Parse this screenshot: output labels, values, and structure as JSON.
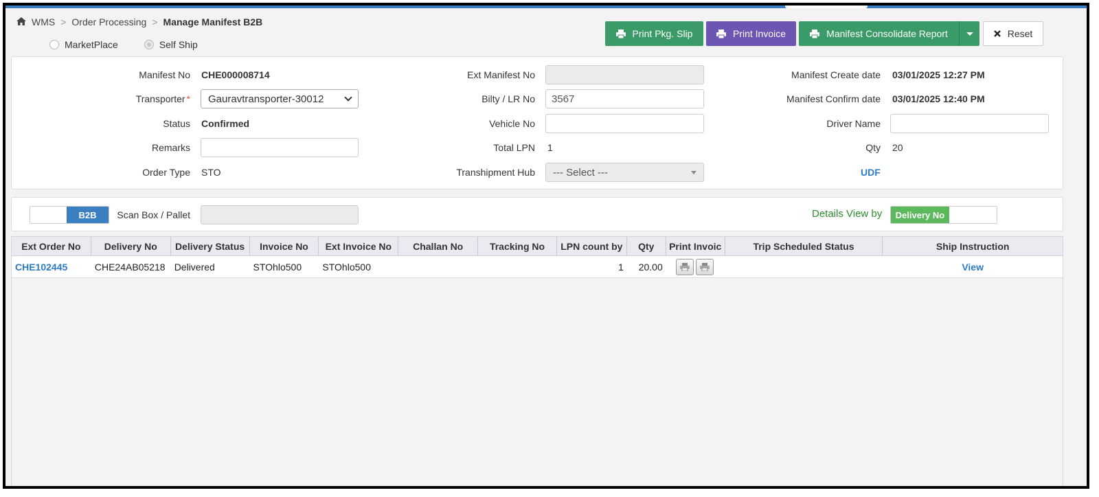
{
  "breadcrumb": {
    "root": "WMS",
    "sep": ">",
    "parent": "Order Processing",
    "current": "Manage Manifest B2B"
  },
  "ship_mode": {
    "options": [
      "MarketPlace",
      "Self Ship"
    ],
    "selected": "Self Ship"
  },
  "toolbar": {
    "print_pkg_slip": "Print Pkg. Slip",
    "print_invoice": "Print Invoice",
    "manifest_report": "Manifest Consolidate Report",
    "reset": "Reset"
  },
  "icons": {
    "home": "home-icon",
    "printer": "printer-icon",
    "close": "close-icon",
    "caret": "caret-down-icon"
  },
  "colors": {
    "green": "#3a9a68",
    "purple": "#6d55b3",
    "blue": "#3a7fc2",
    "link": "#2b7bc4",
    "toggle_green": "#5cb85c"
  },
  "form": {
    "manifest_no_label": "Manifest No",
    "manifest_no": "CHE000008714",
    "transporter_label": "Transporter",
    "required_mark": "*",
    "transporter": "Gauravtransporter-30012",
    "status_label": "Status",
    "status": "Confirmed",
    "remarks_label": "Remarks",
    "remarks": "",
    "order_type_label": "Order Type",
    "order_type": "STO",
    "ext_manifest_label": "Ext Manifest No",
    "ext_manifest": "",
    "bilty_label": "Bilty / LR No",
    "bilty": "3567",
    "vehicle_label": "Vehicle No",
    "vehicle": "",
    "total_lpn_label": "Total LPN",
    "total_lpn": "1",
    "hub_label": "Transhipment Hub",
    "hub": "--- Select ---",
    "create_date_label": "Manifest Create date",
    "create_date": "03/01/2025 12:27 PM",
    "confirm_date_label": "Manifest Confirm date",
    "confirm_date": "03/01/2025 12:40 PM",
    "driver_label": "Driver Name",
    "driver": "",
    "qty_label": "Qty",
    "qty": "20",
    "udf": "UDF"
  },
  "scan": {
    "toggle_label": "B2B",
    "scan_label": "Scan Box / Pallet",
    "scan_value": "",
    "details_label": "Details View by",
    "details_toggle": "Delivery No"
  },
  "table": {
    "headers": [
      "Ext Order No",
      "Delivery No",
      "Delivery Status",
      "Invoice No",
      "Ext Invoice No",
      "Challan No",
      "Tracking No",
      "LPN count by",
      "Qty",
      "Print Invoic",
      "Trip Scheduled Status",
      "Ship Instruction"
    ],
    "rows": [
      {
        "ext_order_no": "CHE102445",
        "delivery_no": "CHE24AB05218",
        "delivery_status": "Delivered",
        "invoice_no": "STOhlo500",
        "ext_invoice_no": "STOhlo500",
        "challan_no": "",
        "tracking_no": "",
        "lpn_count": "1",
        "qty": "20.00",
        "trip_status": "",
        "ship_instruction": "View"
      }
    ]
  }
}
